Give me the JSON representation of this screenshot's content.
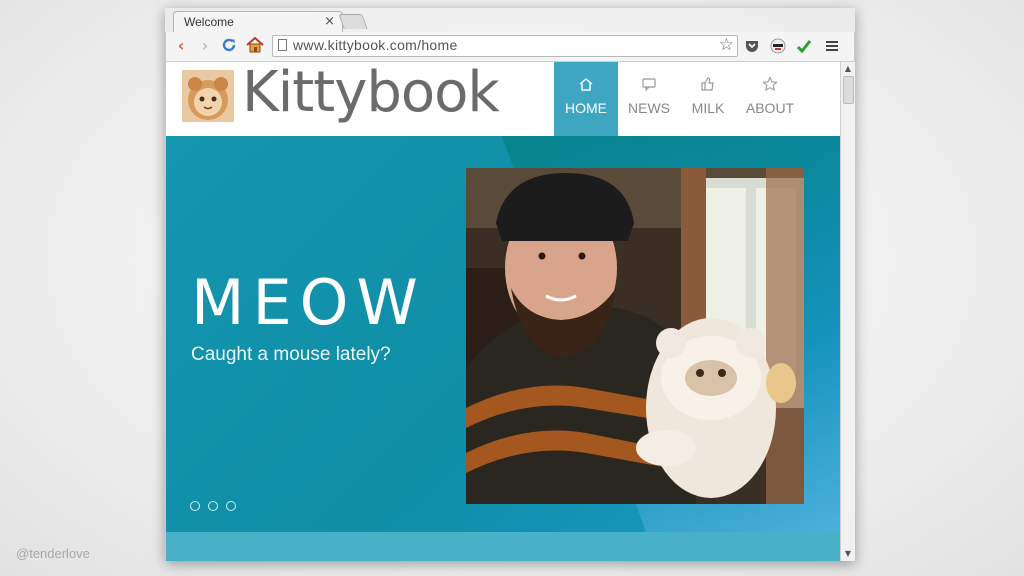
{
  "watermark": "@tenderlove",
  "browser": {
    "tab_title": "Welcome",
    "tab_close": "×",
    "url": "www.kittybook.com/home",
    "back_icon": "back-arrow-icon",
    "forward_icon": "forward-arrow-icon",
    "reload_icon": "reload-icon",
    "home_icon": "home-icon"
  },
  "site": {
    "brand": "Kittybook",
    "nav": [
      {
        "label": "HOME",
        "icon": "home-icon",
        "active": true
      },
      {
        "label": "NEWS",
        "icon": "speech-bubble-icon",
        "active": false
      },
      {
        "label": "MILK",
        "icon": "thumbs-up-icon",
        "active": false
      },
      {
        "label": "ABOUT",
        "icon": "star-icon",
        "active": false
      }
    ],
    "hero": {
      "title": "MEOW",
      "subtitle": "Caught a mouse lately?",
      "dot_count": 3
    }
  },
  "colors": {
    "hero_bg": "#1596ae",
    "nav_active": "#3fa6c2",
    "footer_band": "#48b1c8",
    "brand_text": "#6b6b6b"
  }
}
